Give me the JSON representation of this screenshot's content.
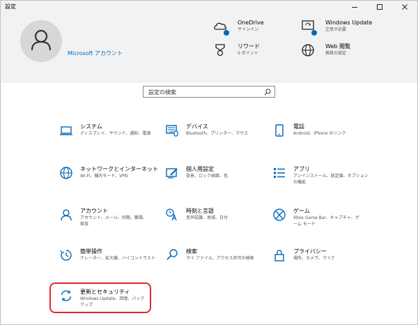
{
  "window": {
    "title": "設定"
  },
  "header": {
    "account_label": "Microsoft アカウント",
    "items": [
      {
        "title": "OneDrive",
        "sub": "サインイン",
        "icon": "cloud-icon"
      },
      {
        "title": "Windows Update",
        "sub": "注意が必要",
        "icon": "update-icon"
      },
      {
        "title": "リワード",
        "sub": "0 ポイント",
        "icon": "trophy-icon"
      },
      {
        "title": "Web 閲覧",
        "sub": "推奨の設定",
        "icon": "globe-icon"
      }
    ]
  },
  "search": {
    "placeholder": "設定の検索"
  },
  "categories": [
    {
      "title": "システム",
      "desc": "ディスプレイ、サウンド、通知、電源",
      "icon": "laptop-icon"
    },
    {
      "title": "デバイス",
      "desc": "Bluetooth、プリンター、マウス",
      "icon": "keyboard-icon"
    },
    {
      "title": "電話",
      "desc": "Android、iPhone のリンク",
      "icon": "phone-icon"
    },
    {
      "title": "ネットワークとインターネット",
      "desc": "Wi-Fi、機内モード、VPN",
      "icon": "globe-icon"
    },
    {
      "title": "個人用設定",
      "desc": "背景、ロック画面、色",
      "icon": "paint-icon"
    },
    {
      "title": "アプリ",
      "desc": "アンインストール、既定値、オプション の機能",
      "icon": "apps-list-icon"
    },
    {
      "title": "アカウント",
      "desc": "アカウント、メール、同期、職場、家族",
      "icon": "person-icon"
    },
    {
      "title": "時刻と言語",
      "desc": "音声認識、地域、日付",
      "icon": "time-language-icon"
    },
    {
      "title": "ゲーム",
      "desc": "Xbox Game Bar、キャプチャ、ゲーム モード",
      "icon": "xbox-icon"
    },
    {
      "title": "簡単操作",
      "desc": "ナレーター、拡大鏡、ハイコントラスト",
      "icon": "ease-of-access-icon"
    },
    {
      "title": "検索",
      "desc": "マイ ファイル、アクセス許可の検索",
      "icon": "search-icon"
    },
    {
      "title": "プライバシー",
      "desc": "場所、カメラ、マイク",
      "icon": "lock-icon"
    },
    {
      "title": "更新とセキュリティ",
      "desc": "Windows Update、回復、バックアップ",
      "icon": "sync-icon"
    }
  ],
  "colors": {
    "accent": "#0067b8",
    "highlight": "#e0282d",
    "header_bg": "#f2f2f2"
  }
}
